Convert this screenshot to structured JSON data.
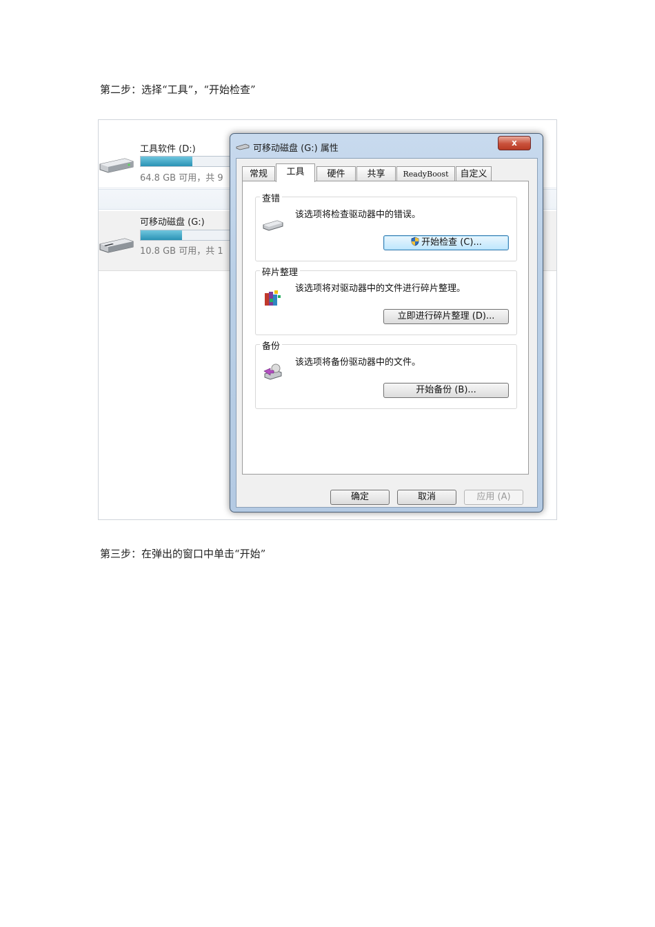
{
  "document": {
    "step2_text": "第二步：选择“工具”，“开始检查”",
    "step3_text": "第三步：在弹出的窗口中单击“开始”"
  },
  "explorer": {
    "drive_d": {
      "name": "工具软件 (D:)",
      "free": "64.8 GB 可用，共 9",
      "usage_fraction": 0.56
    },
    "drive_g": {
      "name": "可移动磁盘 (G:)",
      "free": "10.8 GB 可用，共 1",
      "usage_fraction": 0.45
    }
  },
  "dialog": {
    "title": "可移动磁盘 (G:) 属性",
    "close_label": "x",
    "tabs": [
      {
        "label": "常规",
        "active": false
      },
      {
        "label": "工具",
        "active": true
      },
      {
        "label": "硬件",
        "active": false
      },
      {
        "label": "共享",
        "active": false
      },
      {
        "label": "ReadyBoost",
        "active": false
      },
      {
        "label": "自定义",
        "active": false
      }
    ],
    "groups": {
      "check": {
        "title": "查错",
        "description": "该选项将检查驱动器中的错误。",
        "button": "开始检查 (C)..."
      },
      "defrag": {
        "title": "碎片整理",
        "description": "该选项将对驱动器中的文件进行碎片整理。",
        "button": "立即进行碎片整理 (D)..."
      },
      "backup": {
        "title": "备份",
        "description": "该选项将备份驱动器中的文件。",
        "button": "开始备份 (B)..."
      }
    },
    "buttons": {
      "ok": "确定",
      "cancel": "取消",
      "apply": "应用 (A)"
    }
  },
  "colors": {
    "progress_fill": "#2a92b4",
    "dialog_frame": "#b9cfe6",
    "close_button": "#c9513b"
  }
}
